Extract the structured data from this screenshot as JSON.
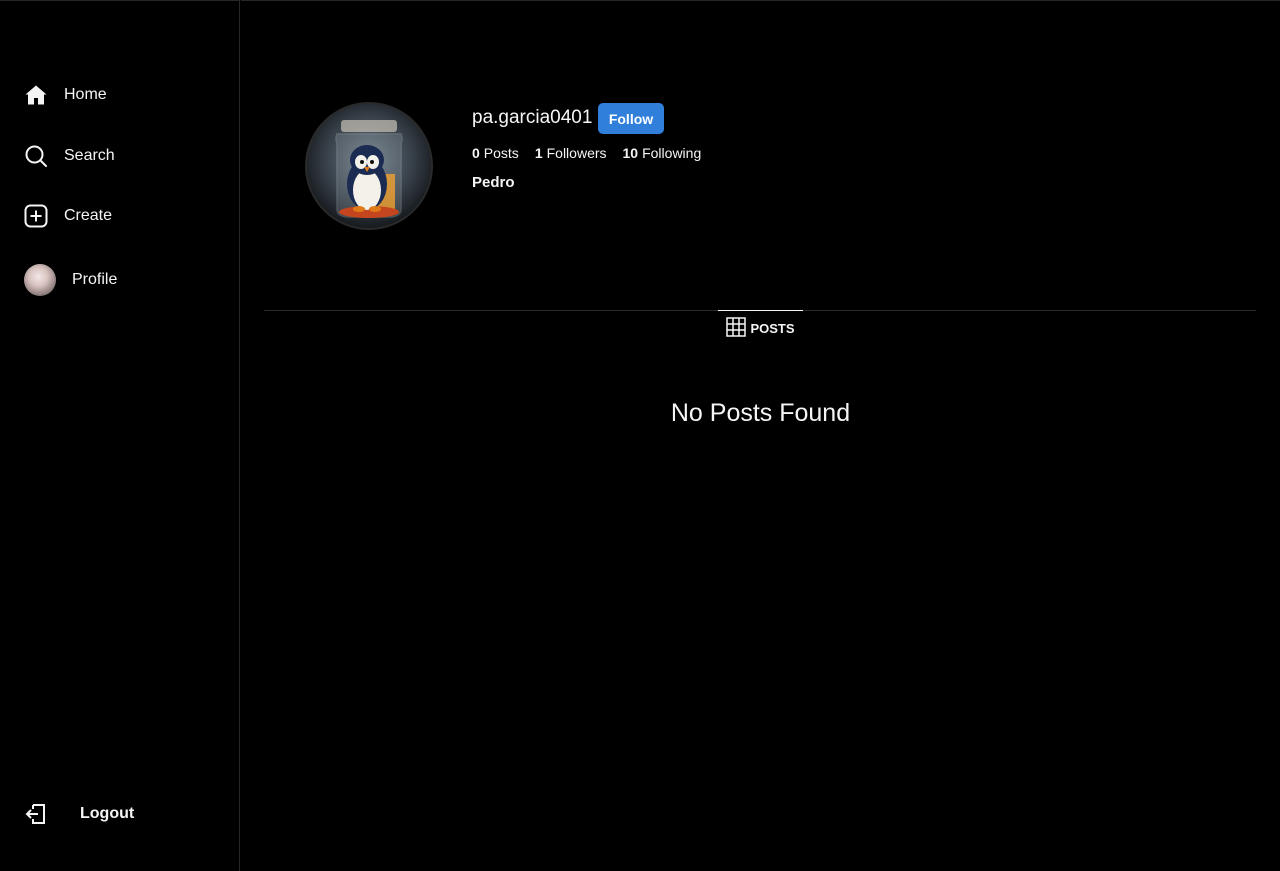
{
  "sidebar": {
    "home_label": "Home",
    "search_label": "Search",
    "create_label": "Create",
    "profile_label": "Profile",
    "logout_label": "Logout"
  },
  "profile": {
    "username": "pa.garcia0401",
    "follow_label": "Follow",
    "posts_count": "0",
    "posts_label": "Posts",
    "followers_count": "1",
    "followers_label": "Followers",
    "following_count": "10",
    "following_label": "Following",
    "full_name": "Pedro"
  },
  "tabs": {
    "posts_label": "POSTS"
  },
  "empty_message": "No Posts Found",
  "colors": {
    "background": "#000000",
    "follow_button": "#2f7fdb",
    "text": "#f5f5f5"
  }
}
